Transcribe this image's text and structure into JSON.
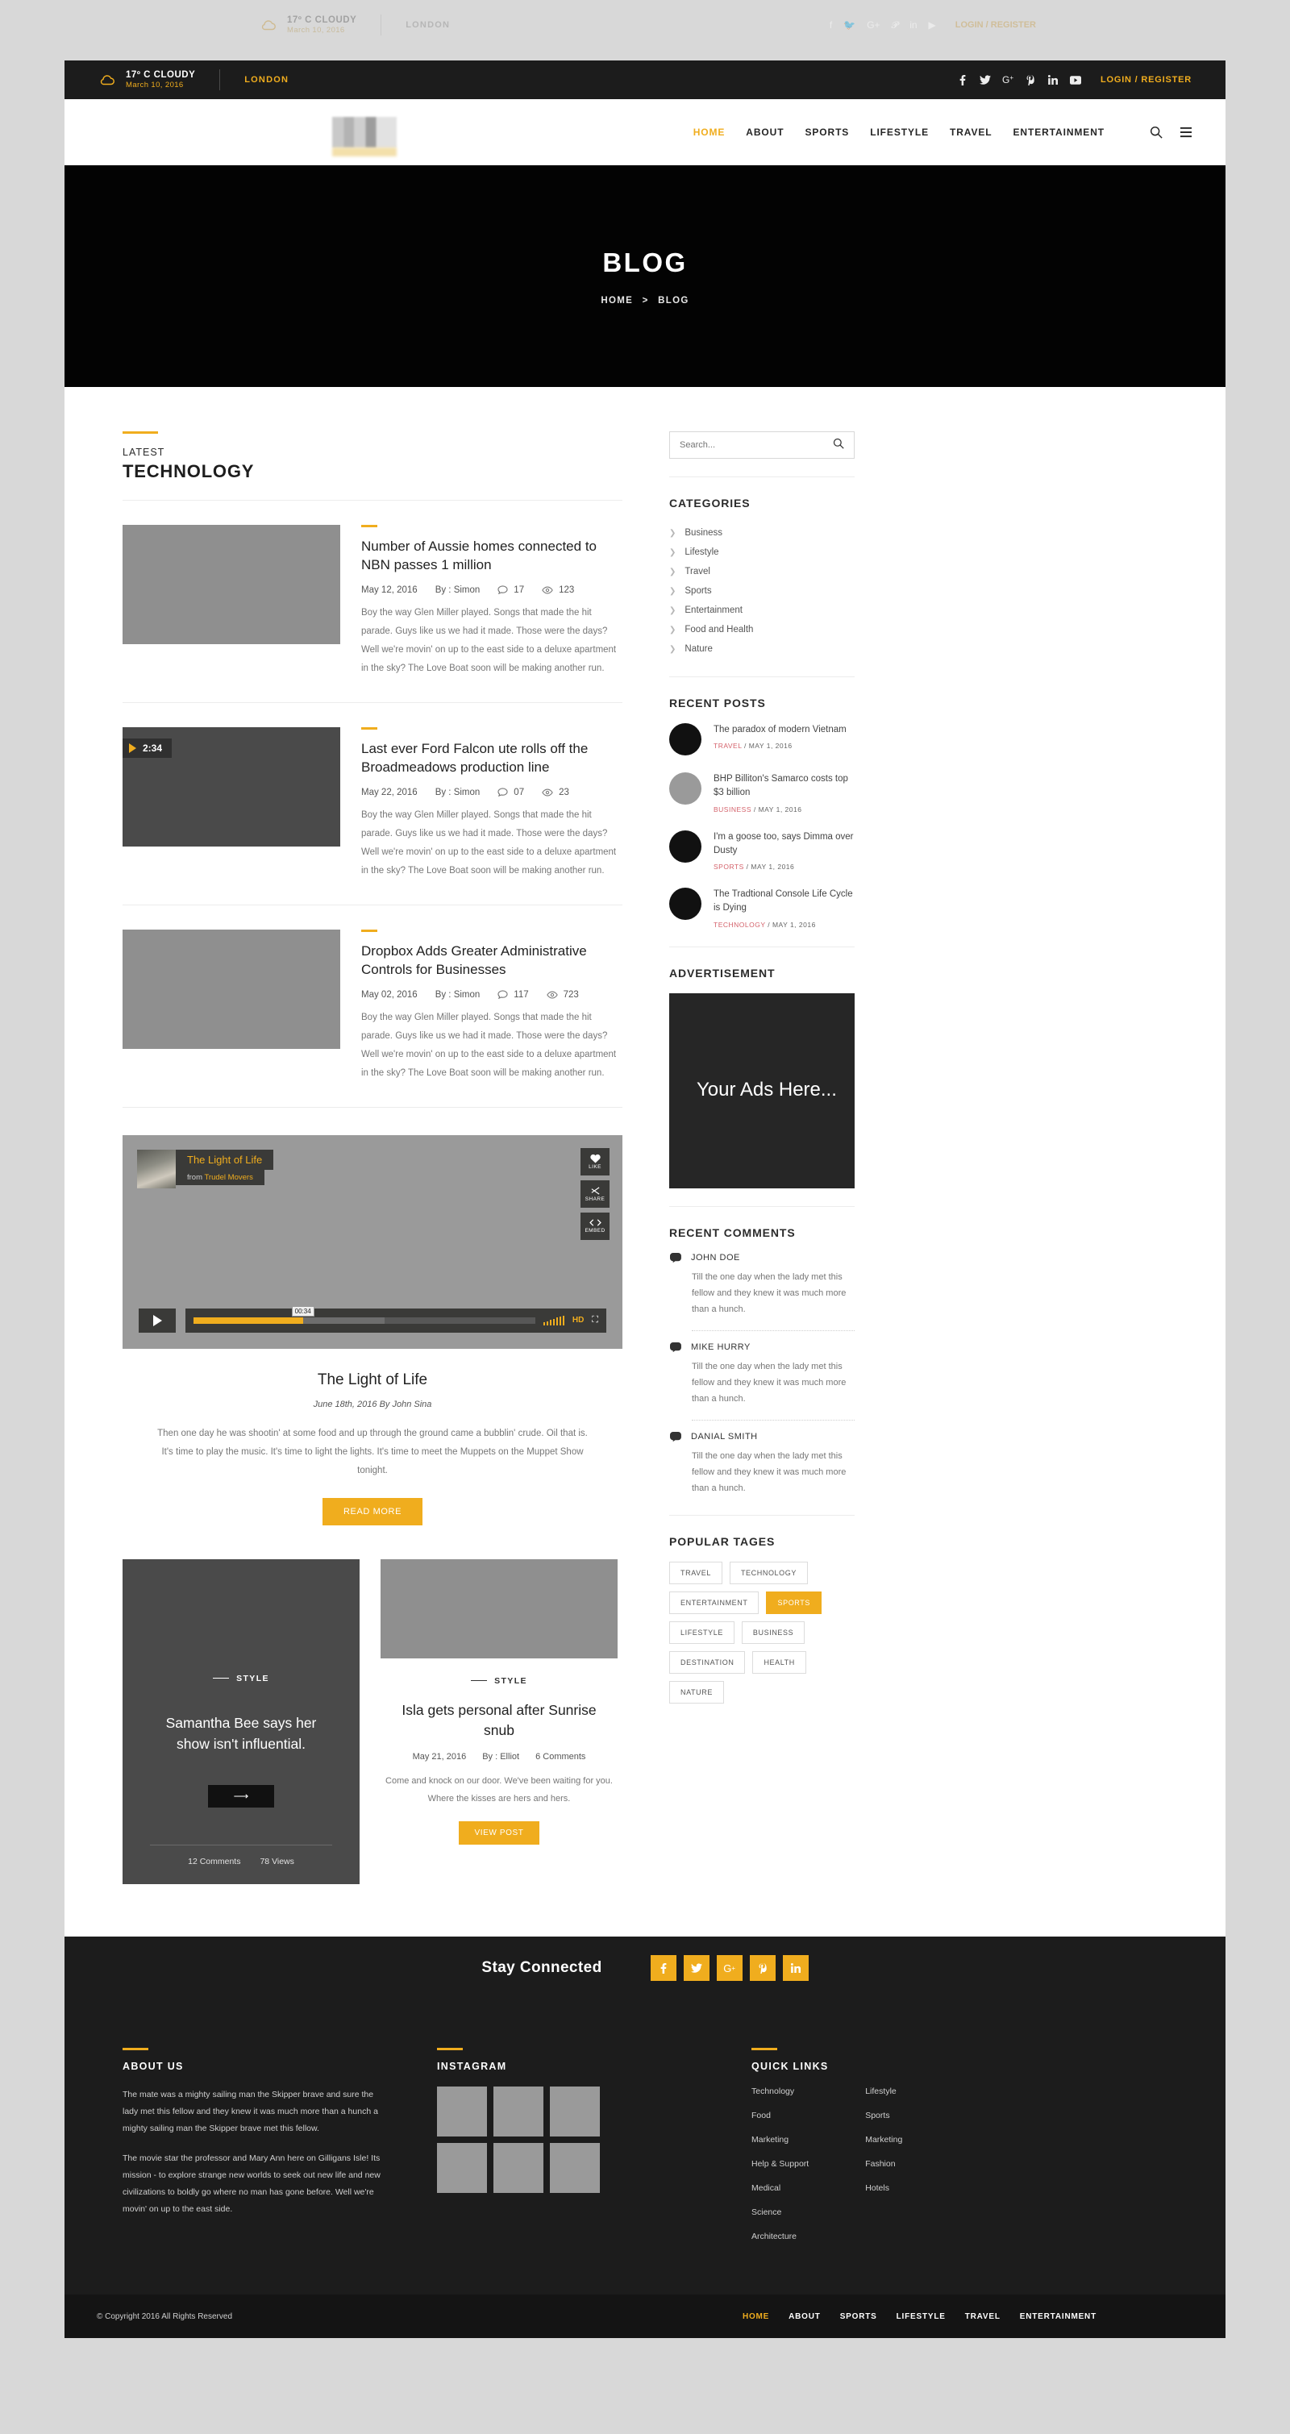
{
  "topbar": {
    "temp": "17º C  CLOUDY",
    "date": "March 10, 2016",
    "city": "LONDON",
    "login": "LOGIN / REGISTER",
    "socials": [
      "facebook-icon",
      "twitter-icon",
      "google-plus-icon",
      "pinterest-icon",
      "linkedin-icon",
      "youtube-icon"
    ]
  },
  "nav": {
    "items": [
      {
        "label": "HOME",
        "active": true
      },
      {
        "label": "ABOUT",
        "active": false
      },
      {
        "label": "SPORTS",
        "active": false
      },
      {
        "label": "LIFESTYLE",
        "active": false
      },
      {
        "label": "TRAVEL",
        "active": false
      },
      {
        "label": "ENTERTAINMENT",
        "active": false
      }
    ],
    "search_icon": "search-icon",
    "menu_icon": "hamburger-icon"
  },
  "hero": {
    "title": "BLOG",
    "crumb_home": "HOME",
    "crumb_sep": ">",
    "crumb_current": "BLOG"
  },
  "section": {
    "small": "LATEST",
    "big": "TECHNOLOGY"
  },
  "posts": [
    {
      "title": "Number of Aussie homes connected to NBN passes 1 million",
      "date": "May 12, 2016",
      "author": "By : Simon",
      "comments": "17",
      "views": "123",
      "excerpt": "Boy the way Glen Miller played. Songs that made the hit parade. Guys like us we had it made. Those were the days? Well we're movin' on up to the east side to a deluxe apartment in the sky? The Love Boat soon will be making another run."
    },
    {
      "title": "Last ever Ford Falcon ute rolls off the Broadmeadows production line",
      "date": "May 22, 2016",
      "author": "By : Simon",
      "comments": "07",
      "views": "23",
      "excerpt": "Boy the way Glen Miller played. Songs that made the hit parade. Guys like us we had it made. Those were the days? Well we're movin' on up to the east side to a deluxe apartment in the sky? The Love Boat soon will be making another run.",
      "video_duration": "2:34"
    },
    {
      "title": "Dropbox Adds Greater Administrative Controls for Businesses",
      "date": "May 02, 2016",
      "author": "By : Simon",
      "comments": "117",
      "views": "723",
      "excerpt": "Boy the way Glen Miller played. Songs that made the hit parade. Guys like us we had it made. Those were the days? Well we're movin' on up to the east side to a deluxe apartment in the sky? The Love Boat soon will be making another run."
    }
  ],
  "video": {
    "title": "The Light of Life",
    "from_label": "from",
    "from_name": "Trudel Movers",
    "like_label": "LIKE",
    "share_label": "SHARE",
    "embed_label": "EMBED",
    "time": "00:34",
    "hd_label": "HD",
    "caption_title": "The Light of Life",
    "caption_meta": "June 18th, 2016  By  John Sina",
    "caption_text": "Then one day he was shootin' at some food and up through the ground came a bubblin' crude. Oil that is. It's time to play the music. It's time to light the lights. It's time to meet the Muppets on the Muppet Show tonight.",
    "read_more": "READ MORE"
  },
  "cards": {
    "dark": {
      "kicker": "STYLE",
      "title": "Samantha Bee says her show isn't influential.",
      "arrow": "⟶",
      "comments": "12 Comments",
      "views": "78 Views"
    },
    "light": {
      "kicker": "STYLE",
      "title": "Isla gets personal after Sunrise snub",
      "date": "May 21, 2016",
      "author": "By : Elliot",
      "comments": "6 Comments",
      "excerpt": "Come and knock on our door. We've been waiting for you. Where the kisses are hers and hers.",
      "button": "VIEW POST"
    }
  },
  "sidebar": {
    "search_placeholder": "Search...",
    "search_value": "",
    "categories_title": "CATEGORIES",
    "categories": [
      "Business",
      "Lifestyle",
      "Travel",
      "Sports",
      "Entertainment",
      "Food and Health",
      "Nature"
    ],
    "recent_title": "RECENT POSTS",
    "recent": [
      {
        "title": "The paradox of modern Vietnam",
        "cat": "TRAVEL",
        "date": "MAY 1, 2016",
        "avatar": "dark"
      },
      {
        "title": "BHP Billiton's Samarco costs top $3 billion",
        "cat": "BUSINESS",
        "date": "MAY 1, 2016",
        "avatar": "gray"
      },
      {
        "title": "I'm a goose too, says Dimma over Dusty",
        "cat": "SPORTS",
        "date": "MAY 1, 2016",
        "avatar": "dark"
      },
      {
        "title": "The Tradtional Console Life Cycle is Dying",
        "cat": "TECHNOLOGY",
        "date": "MAY 1, 2016",
        "avatar": "dark"
      }
    ],
    "ad_title": "ADVERTISEMENT",
    "ad_text": "Your Ads Here...",
    "comments_title": "RECENT COMMENTS",
    "comments": [
      {
        "name": "JOHN DOE",
        "text": "Till the one day when the lady met this fellow and they knew it was much more than a hunch."
      },
      {
        "name": "MIKE HURRY",
        "text": "Till the one day when the lady met this fellow and they knew it was much more than a hunch."
      },
      {
        "name": "DANIAL SMITH",
        "text": "Till the one day when the lady met this fellow and they knew it was much more than a hunch."
      }
    ],
    "tags_title": "POPULAR TAGES",
    "tags": [
      {
        "label": "TRAVEL",
        "active": false
      },
      {
        "label": "TECHNOLOGY",
        "active": false
      },
      {
        "label": "ENTERTAINMENT",
        "active": false
      },
      {
        "label": "SPORTS",
        "active": true
      },
      {
        "label": "LIFESTYLE",
        "active": false
      },
      {
        "label": "BUSINESS",
        "active": false
      },
      {
        "label": "DESTINATION",
        "active": false
      },
      {
        "label": "HEALTH",
        "active": false
      },
      {
        "label": "NATURE",
        "active": false
      }
    ]
  },
  "stay": {
    "title": "Stay Connected",
    "socials": [
      "facebook-icon",
      "twitter-icon",
      "google-plus-icon",
      "pinterest-icon",
      "linkedin-icon"
    ]
  },
  "footer": {
    "about_title": "ABOUT US",
    "about_p1": "The mate was a mighty sailing man the Skipper brave and sure the lady met this fellow and they knew it was much more than a hunch a mighty sailing man the Skipper brave met this fellow.",
    "about_p2": "The movie star the professor and Mary Ann here on Gilligans Isle! Its mission - to explore strange new worlds to seek out new life and new civilizations to boldly go where no man has gone before. Well we're movin' on up to the east side.",
    "instagram_title": "INSTAGRAM",
    "quick_title": "QUICK LINKS",
    "quick_col1": [
      "Technology",
      "Food",
      "Marketing",
      "Help & Support",
      "Medical",
      "Science",
      "Architecture"
    ],
    "quick_col2": [
      "Lifestyle",
      "Sports",
      "Marketing",
      "Fashion",
      "Hotels"
    ],
    "copyright": "© Copyright 2016  All Rights Reserved",
    "links": [
      {
        "label": "HOME",
        "active": true
      },
      {
        "label": "ABOUT",
        "active": false
      },
      {
        "label": "SPORTS",
        "active": false
      },
      {
        "label": "LIFESTYLE",
        "active": false
      },
      {
        "label": "TRAVEL",
        "active": false
      },
      {
        "label": "ENTERTAINMENT",
        "active": false
      }
    ]
  },
  "colors": {
    "accent": "#f0ad1e",
    "dark": "#1c1c1c",
    "hero": "#030303",
    "red": "#d4626b"
  }
}
